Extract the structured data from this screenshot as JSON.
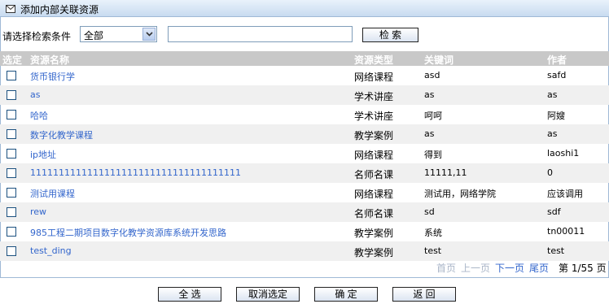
{
  "window": {
    "title": "添加内部关联资源",
    "icon": "envelope-icon"
  },
  "search": {
    "label": "请选择检索条件",
    "select_value": "全部",
    "input_value": "",
    "button_label": "检 索"
  },
  "table": {
    "headers": {
      "select": "选定",
      "name": "资源名称",
      "type": "资源类型",
      "keywords": "关键词",
      "author": "作者"
    },
    "rows": [
      {
        "name": "货币银行学",
        "type": "网络课程",
        "keywords": "asd",
        "author": "safd",
        "checked": false
      },
      {
        "name": "as",
        "type": "学术讲座",
        "keywords": "as",
        "author": "as",
        "checked": false
      },
      {
        "name": "哈哈",
        "type": "学术讲座",
        "keywords": "呵呵",
        "author": "阿嫂",
        "checked": false
      },
      {
        "name": "数字化教学课程",
        "type": "教学案例",
        "keywords": "as",
        "author": "as",
        "checked": false
      },
      {
        "name": "ip地址",
        "type": "网络课程",
        "keywords": "得到",
        "author": "laoshi1",
        "checked": false
      },
      {
        "name": "1111111111111111111111111111111111111",
        "type": "名师名课",
        "keywords": "11111,11",
        "author": "0",
        "checked": false
      },
      {
        "name": "测试用课程",
        "type": "网络课程",
        "keywords": "测试用，网络学院",
        "author": "应该调用",
        "checked": false
      },
      {
        "name": "rew",
        "type": "名师名课",
        "keywords": "sd",
        "author": "sdf",
        "checked": false
      },
      {
        "name": "985工程二期项目数字化教学资源库系统开发思路",
        "type": "教学案例",
        "keywords": "系统",
        "author": "tn00011",
        "checked": false
      },
      {
        "name": "test_ding",
        "type": "教学案例",
        "keywords": "test",
        "author": "test",
        "checked": false
      }
    ]
  },
  "pagination": {
    "first": "首页",
    "prev": "上一页",
    "next": "下一页",
    "last": "尾页",
    "status": "第 1/55 页"
  },
  "actions": {
    "select_all": "全 选",
    "deselect": "取消选定",
    "confirm": "确 定",
    "back": "返 回"
  },
  "colors": {
    "link": "#3366cc",
    "header_bg": "#c8c8c8",
    "alt_row": "#f0f0f0",
    "disabled": "#aab6c8"
  }
}
